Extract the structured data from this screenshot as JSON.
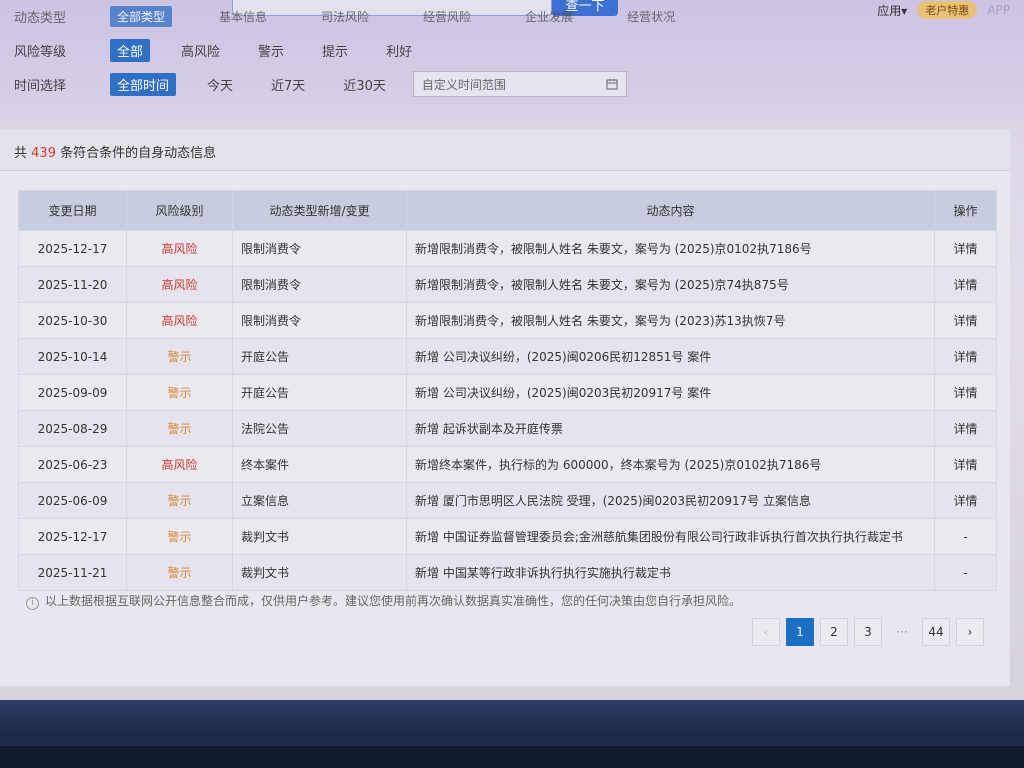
{
  "filters": {
    "type_label": "动态类型",
    "type_options": [
      "全部类型",
      "基本信息",
      "司法风险",
      "经营风险",
      "企业发展",
      "经营状况"
    ],
    "risk_label": "风险等级",
    "risk_options": [
      "全部",
      "高风险",
      "警示",
      "提示",
      "利好"
    ],
    "time_label": "时间选择",
    "time_options": [
      "全部时间",
      "今天",
      "近7天",
      "近30天"
    ],
    "range_placeholder": "自定义时间范围",
    "search_button": "查一下"
  },
  "topbar": {
    "app_menu": "应用▾",
    "vip_label": "老户特惠",
    "app_link": "APP"
  },
  "summary": {
    "prefix": "共",
    "count": "439",
    "suffix": "条符合条件的自身动态信息"
  },
  "table": {
    "headers": [
      "变更日期",
      "风险级别",
      "动态类型新增/变更",
      "动态内容",
      "操作"
    ],
    "rows": [
      {
        "date": "2025-12-17",
        "risk": "高风险",
        "level": "high",
        "type": "限制消费令",
        "content": "新增限制消费令，被限制人姓名 朱要文，案号为 (2025)京0102执7186号",
        "op": "详情"
      },
      {
        "date": "2025-11-20",
        "risk": "高风险",
        "level": "high",
        "type": "限制消费令",
        "content": "新增限制消费令，被限制人姓名 朱要文，案号为 (2025)京74执875号",
        "op": "详情"
      },
      {
        "date": "2025-10-30",
        "risk": "高风险",
        "level": "high",
        "type": "限制消费令",
        "content": "新增限制消费令，被限制人姓名 朱要文，案号为 (2023)苏13执恢7号",
        "op": "详情"
      },
      {
        "date": "2025-10-14",
        "risk": "警示",
        "level": "warn",
        "type": "开庭公告",
        "content": "新增 公司决议纠纷，(2025)闽0206民初12851号 案件",
        "op": "详情"
      },
      {
        "date": "2025-09-09",
        "risk": "警示",
        "level": "warn",
        "type": "开庭公告",
        "content": "新增 公司决议纠纷，(2025)闽0203民初20917号 案件",
        "op": "详情"
      },
      {
        "date": "2025-08-29",
        "risk": "警示",
        "level": "warn",
        "type": "法院公告",
        "content": "新增 起诉状副本及开庭传票",
        "op": "详情"
      },
      {
        "date": "2025-06-23",
        "risk": "高风险",
        "level": "high",
        "type": "终本案件",
        "content": "新增终本案件，执行标的为 600000，终本案号为 (2025)京0102执7186号",
        "op": "详情"
      },
      {
        "date": "2025-06-09",
        "risk": "警示",
        "level": "warn",
        "type": "立案信息",
        "content": "新增 厦门市思明区人民法院 受理，(2025)闽0203民初20917号 立案信息",
        "op": "详情"
      },
      {
        "date": "2025-12-17",
        "risk": "警示",
        "level": "warn",
        "type": "裁判文书",
        "content": "新增 中国证券监督管理委员会;金洲慈航集团股份有限公司行政非诉执行首次执行执行裁定书",
        "op": "-"
      },
      {
        "date": "2025-11-21",
        "risk": "警示",
        "level": "warn",
        "type": "裁判文书",
        "content": "新增 中国某等行政非诉执行执行实施执行裁定书",
        "op": "-"
      }
    ]
  },
  "disclaimer": "以上数据根据互联网公开信息整合而成，仅供用户参考。建议您使用前再次确认数据真实准确性，您的任何决策由您自行承担风险。",
  "pagination": {
    "prev": "‹",
    "pages": [
      "1",
      "2",
      "3"
    ],
    "ellipsis": "···",
    "last": "44",
    "next": "›",
    "current": "1"
  },
  "colors": {
    "accent": "#2f6fc4",
    "high_risk": "#c9392e",
    "warning": "#d48a36",
    "link": "#4a86c9"
  }
}
